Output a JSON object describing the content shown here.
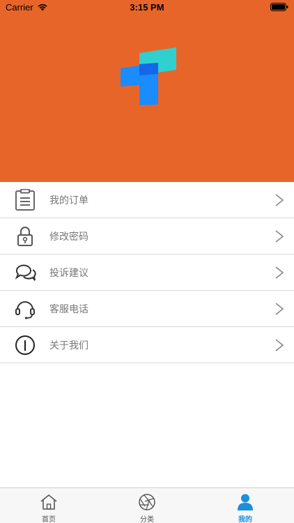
{
  "status_bar": {
    "carrier": "Carrier",
    "time": "3:15 PM"
  },
  "colors": {
    "header_bg": "#e8652a",
    "tab_active": "#1a8fe0"
  },
  "menu": {
    "items": [
      {
        "label": "我的订单",
        "icon": "clipboard-icon"
      },
      {
        "label": "修改密码",
        "icon": "lock-icon"
      },
      {
        "label": "投诉建议",
        "icon": "chat-bubbles-icon"
      },
      {
        "label": "客服电话",
        "icon": "headset-icon"
      },
      {
        "label": "关于我们",
        "icon": "info-icon"
      }
    ]
  },
  "tabbar": {
    "tabs": [
      {
        "label": "首页",
        "icon": "home-icon",
        "active": false
      },
      {
        "label": "分类",
        "icon": "aperture-icon",
        "active": false
      },
      {
        "label": "我的",
        "icon": "user-icon",
        "active": true
      }
    ]
  }
}
